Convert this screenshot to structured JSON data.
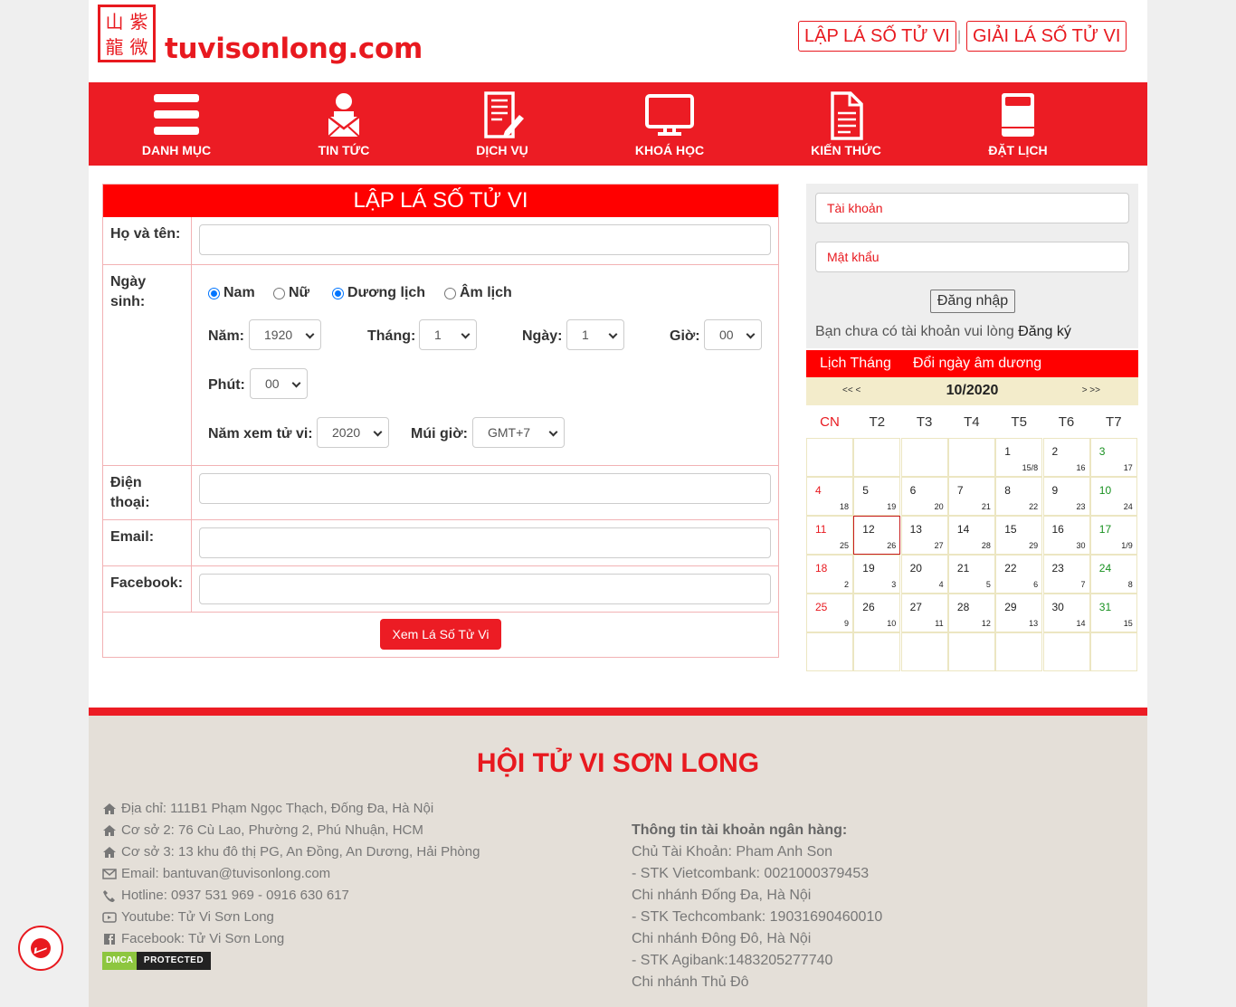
{
  "header": {
    "logo_text": "tuvisonlong.com",
    "logo_seal": [
      "紫",
      "微",
      "山",
      "龍"
    ],
    "btn_lap": "LẬP LÁ SỐ TỬ VI",
    "btn_giai": "GIẢI LÁ SỐ TỬ VI",
    "sep": "|"
  },
  "nav": {
    "items": [
      {
        "label": "DANH MỤC",
        "icon": "menu-icon"
      },
      {
        "label": "TIN TỨC",
        "icon": "person-mail-icon"
      },
      {
        "label": "DỊCH VỤ",
        "icon": "document-pen-icon"
      },
      {
        "label": "KHOÁ HỌC",
        "icon": "monitor-icon"
      },
      {
        "label": "KIẾN THỨC",
        "icon": "document-icon"
      },
      {
        "label": "ĐẶT LỊCH",
        "icon": "book-icon"
      }
    ]
  },
  "form": {
    "title": "LẬP LÁ SỐ TỬ VI",
    "name_label": "Họ và tên:",
    "dob_label": "Ngày sinh:",
    "gender_male": "Nam",
    "gender_female": "Nữ",
    "cal_solar": "Dương lịch",
    "cal_lunar": "Âm lịch",
    "year_label": "Năm:",
    "year_value": "1920",
    "month_label": "Tháng:",
    "month_value": "1",
    "day_label": "Ngày:",
    "day_value": "1",
    "hour_label": "Giờ:",
    "hour_value": "00",
    "minute_label": "Phút:",
    "minute_value": "00",
    "view_year_label": "Năm xem tử vi:",
    "view_year_value": "2020",
    "tz_label": "Múi giờ:",
    "tz_value": "GMT+7",
    "phone_label": "Điện thoại:",
    "email_label": "Email:",
    "facebook_label": "Facebook:",
    "submit": "Xem Lá Số Tử Vi"
  },
  "login": {
    "username_placeholder": "Tài khoản",
    "password_placeholder": "Mật khẩu",
    "login_btn": "Đăng nhập",
    "note": "Bạn chưa có tài khoản vui lòng",
    "register": "Đăng ký"
  },
  "calendar": {
    "tab1": "Lịch Tháng",
    "tab2": "Đổi ngày âm dương",
    "prev": "<< <",
    "next": "> >>",
    "month": "10/2020",
    "weekdays": [
      "CN",
      "T2",
      "T3",
      "T4",
      "T5",
      "T6",
      "T7"
    ],
    "days": [
      [
        "",
        ""
      ],
      [
        "",
        ""
      ],
      [
        "",
        ""
      ],
      [
        "",
        ""
      ],
      [
        "1",
        "15/8"
      ],
      [
        "2",
        "16"
      ],
      [
        "3",
        "17"
      ],
      [
        "4",
        "18"
      ],
      [
        "5",
        "19"
      ],
      [
        "6",
        "20"
      ],
      [
        "7",
        "21"
      ],
      [
        "8",
        "22"
      ],
      [
        "9",
        "23"
      ],
      [
        "10",
        "24"
      ],
      [
        "11",
        "25"
      ],
      [
        "12",
        "26"
      ],
      [
        "13",
        "27"
      ],
      [
        "14",
        "28"
      ],
      [
        "15",
        "29"
      ],
      [
        "16",
        "30"
      ],
      [
        "17",
        "1/9"
      ],
      [
        "18",
        "2"
      ],
      [
        "19",
        "3"
      ],
      [
        "20",
        "4"
      ],
      [
        "21",
        "5"
      ],
      [
        "22",
        "6"
      ],
      [
        "23",
        "7"
      ],
      [
        "24",
        "8"
      ],
      [
        "25",
        "9"
      ],
      [
        "26",
        "10"
      ],
      [
        "27",
        "11"
      ],
      [
        "28",
        "12"
      ],
      [
        "29",
        "13"
      ],
      [
        "30",
        "14"
      ],
      [
        "31",
        "15"
      ],
      [
        "",
        ""
      ],
      [
        "",
        ""
      ],
      [
        "",
        ""
      ],
      [
        "",
        ""
      ],
      [
        "",
        ""
      ],
      [
        "",
        ""
      ],
      [
        "",
        ""
      ]
    ],
    "today": "12"
  },
  "footer": {
    "title": "HỘI TỬ VI SƠN LONG",
    "address": "Địa chỉ:  111B1 Phạm Ngọc Thạch, Đống Đa, Hà Nội",
    "branch2": "Cơ sở 2:  76 Cù Lao, Phường 2, Phú Nhuận, HCM",
    "branch3": "Cơ sở 3:  13 khu đô thị PG, An Đồng, An Dương, Hải Phòng",
    "email": "Email:  bantuvan@tuvisonlong.com",
    "hotline": "Hotline:  0937 531 969 - 0916 630 617",
    "youtube": "Youtube:  Tử Vi Sơn Long",
    "facebook": "Facebook:  Tử Vi Sơn Long",
    "dmca_a": "DMCA",
    "dmca_b": "PROTECTED",
    "bank_title": "Thông tin tài khoản ngân hàng:",
    "bank_lines": [
      "Chủ Tài Khoản: Pham Anh Son",
      "- STK Vietcombank: 0021000379453",
      "Chi nhánh Đống Đa, Hà Nội",
      "- STK Techcombank: 19031690460010",
      "Chi nhánh Đông Đô, Hà Nội",
      "- STK Agibank:1483205277740",
      "Chi nhánh Thủ Đô"
    ]
  },
  "colors": {
    "brand": "#ec1c24",
    "footer_bg": "#e4dfd8"
  }
}
